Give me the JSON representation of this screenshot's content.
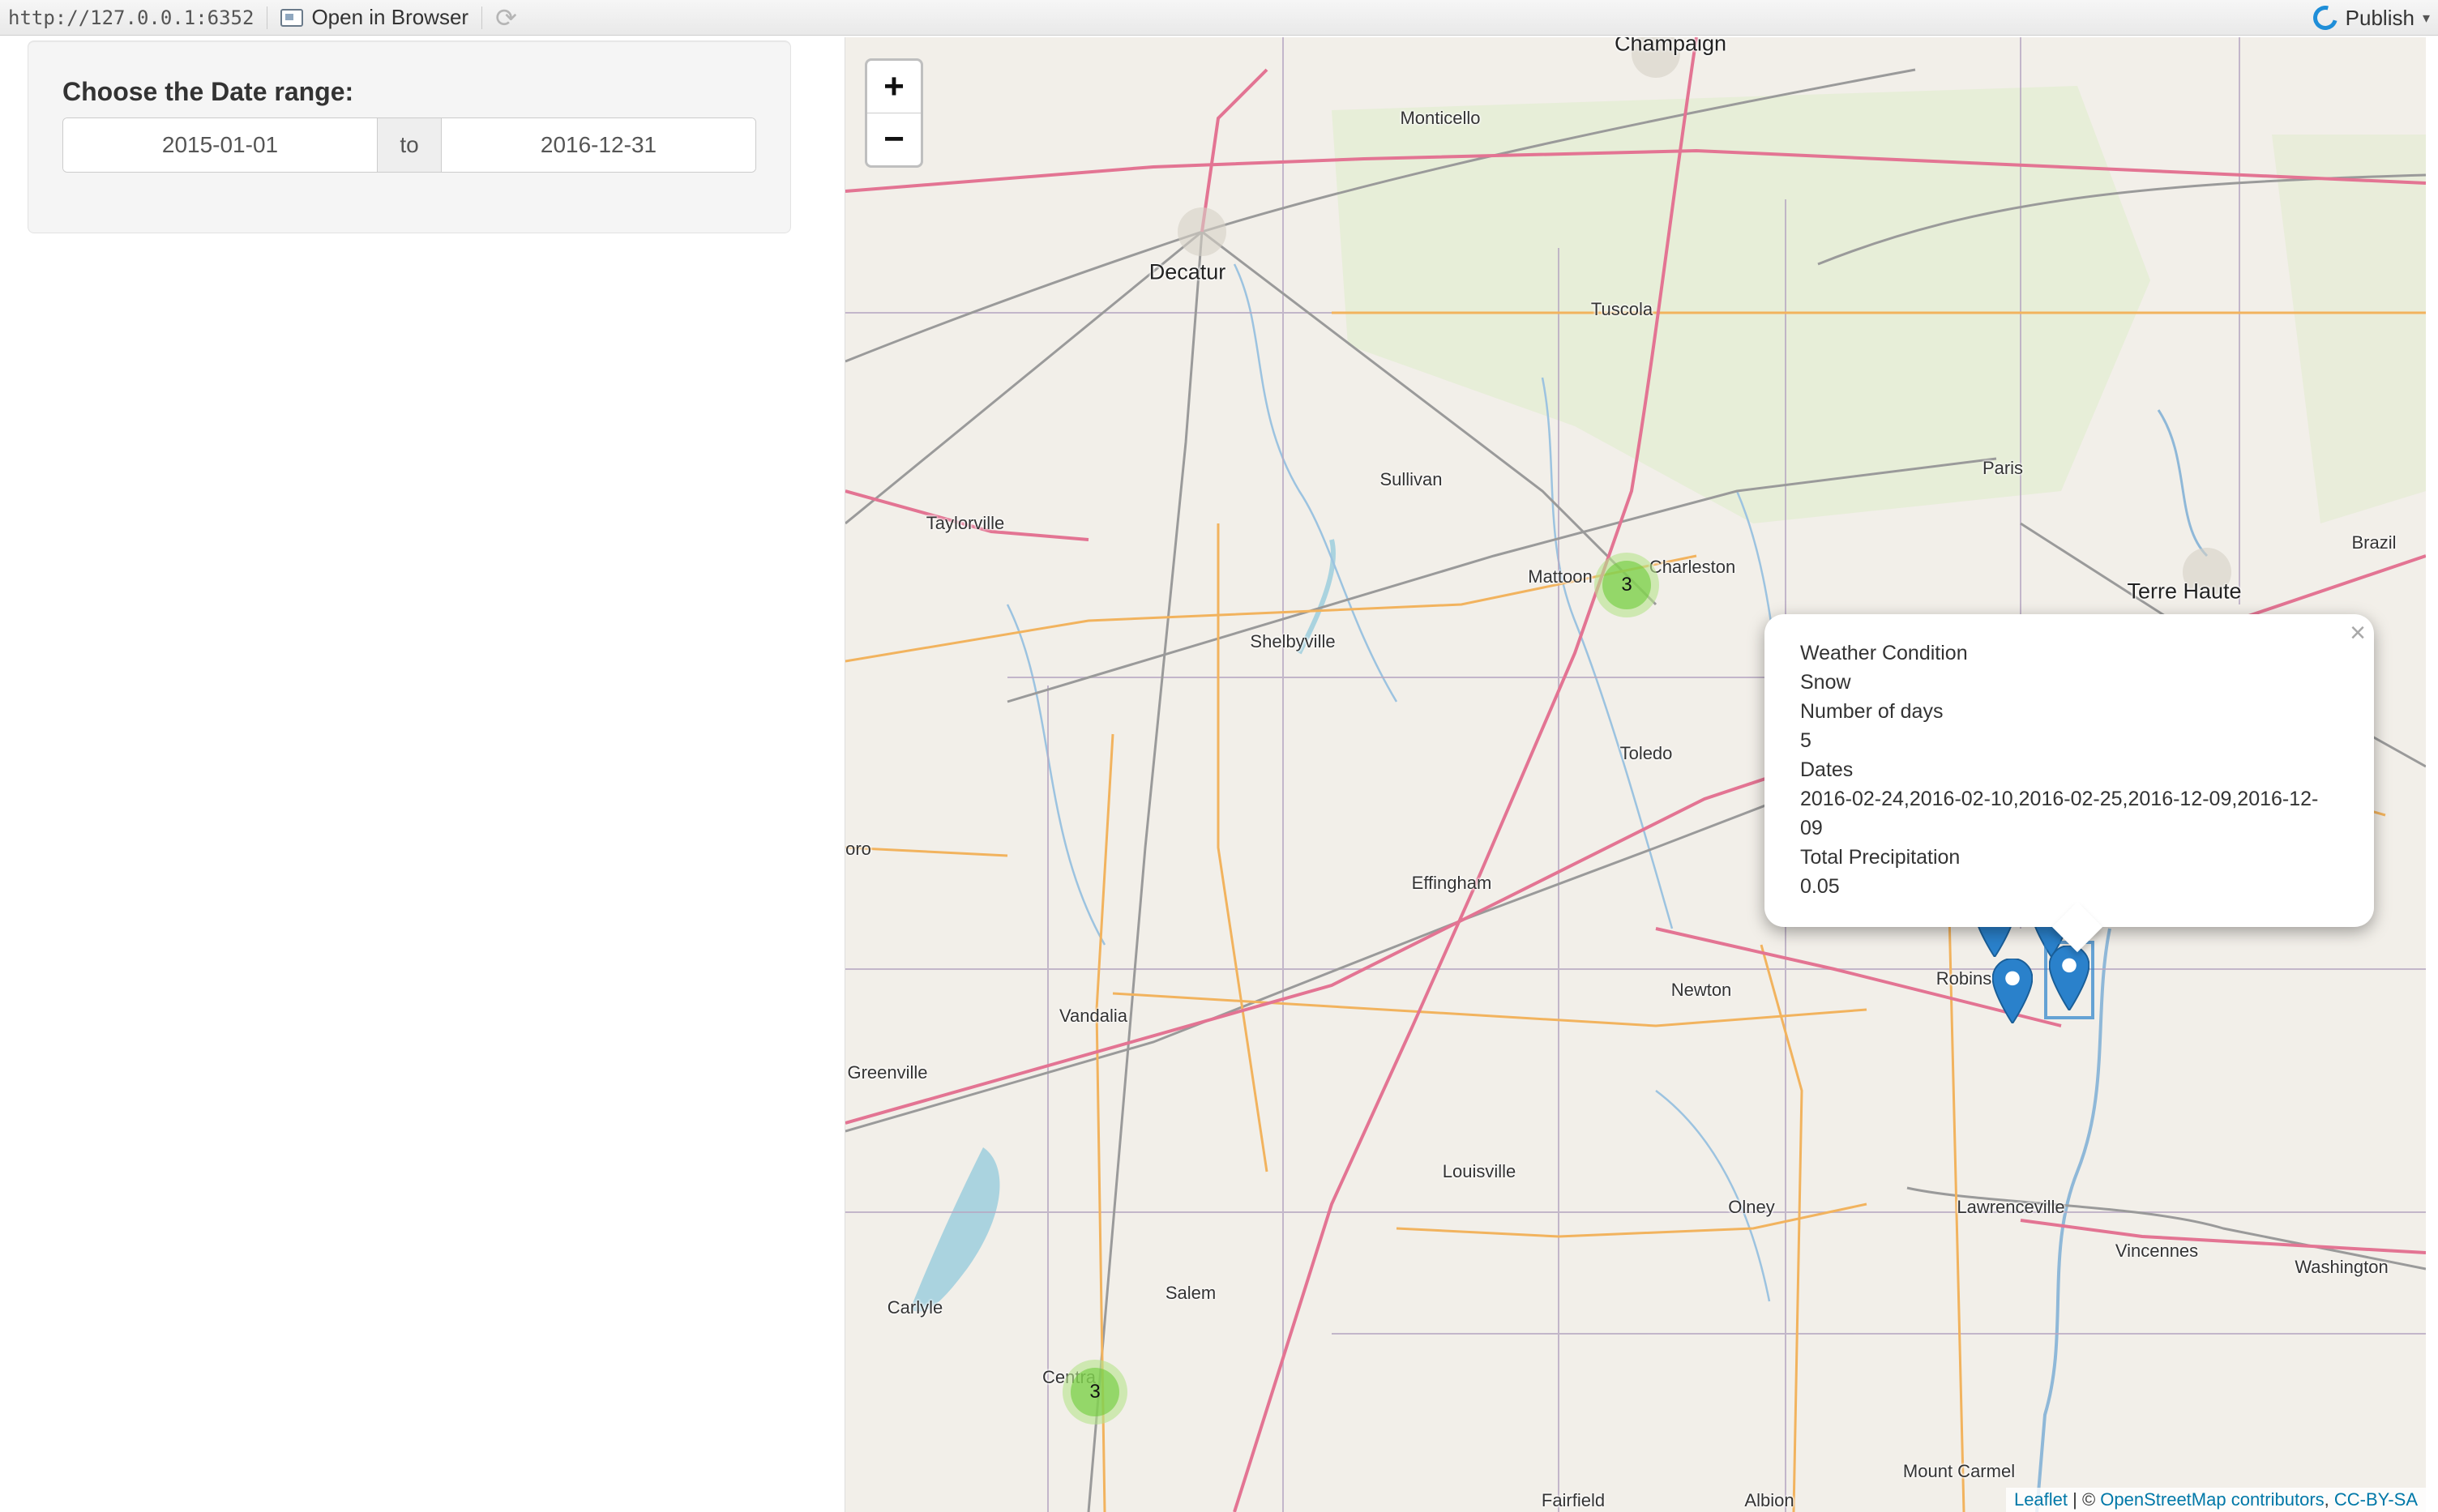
{
  "toolbar": {
    "url": "http://127.0.0.1:6352",
    "open_label": "Open in Browser",
    "publish_label": "Publish"
  },
  "sidebar": {
    "date_label": "Choose the Date range:",
    "start_date": "2015-01-01",
    "separator": "to",
    "end_date": "2016-12-31"
  },
  "map": {
    "zoom_in": "+",
    "zoom_out": "−",
    "cities": {
      "champaign": "Champaign",
      "monticello": "Monticello",
      "decatur": "Decatur",
      "tuscola": "Tuscola",
      "sullivan": "Sullivan",
      "taylorville": "Taylorville",
      "mattoon": "Mattoon",
      "charleston": "Charleston",
      "paris": "Paris",
      "brazil": "Brazil",
      "terre_haute": "Terre Haute",
      "shelbyville": "Shelbyville",
      "toledo": "Toledo",
      "effingham": "Effingham",
      "newton": "Newton",
      "robinson": "Robins",
      "vandalia": "Vandalia",
      "greenville": "Greenville",
      "louisville": "Louisville",
      "olney": "Olney",
      "lawrenceville": "Lawrenceville",
      "vincennes": "Vincennes",
      "washington": "Washington",
      "salem": "Salem",
      "carlyle": "Carlyle",
      "centralia": "Centra",
      "mount_carmel": "Mount Carmel",
      "fairfield": "Fairfield",
      "albion": "Albion",
      "oro": "oro"
    },
    "clusters": [
      {
        "count": "3",
        "name": "cluster-mattoon"
      },
      {
        "count": "3",
        "name": "cluster-centralia"
      }
    ],
    "popup": {
      "close": "×",
      "lines": [
        "Weather Condition",
        "Snow",
        "Number of days",
        "5",
        "Dates",
        "2016-02-24,2016-02-10,2016-02-25,2016-12-09,2016-12-09",
        "Total Precipitation",
        "0.05"
      ]
    },
    "attribution": {
      "leaflet": "Leaflet",
      "sep": " | © ",
      "osm": "OpenStreetMap contributors",
      "license": "CC-BY-SA"
    },
    "colors": {
      "land": "#f2efe9",
      "marker": "#2a81cb",
      "cluster": "#6ecc39"
    }
  }
}
